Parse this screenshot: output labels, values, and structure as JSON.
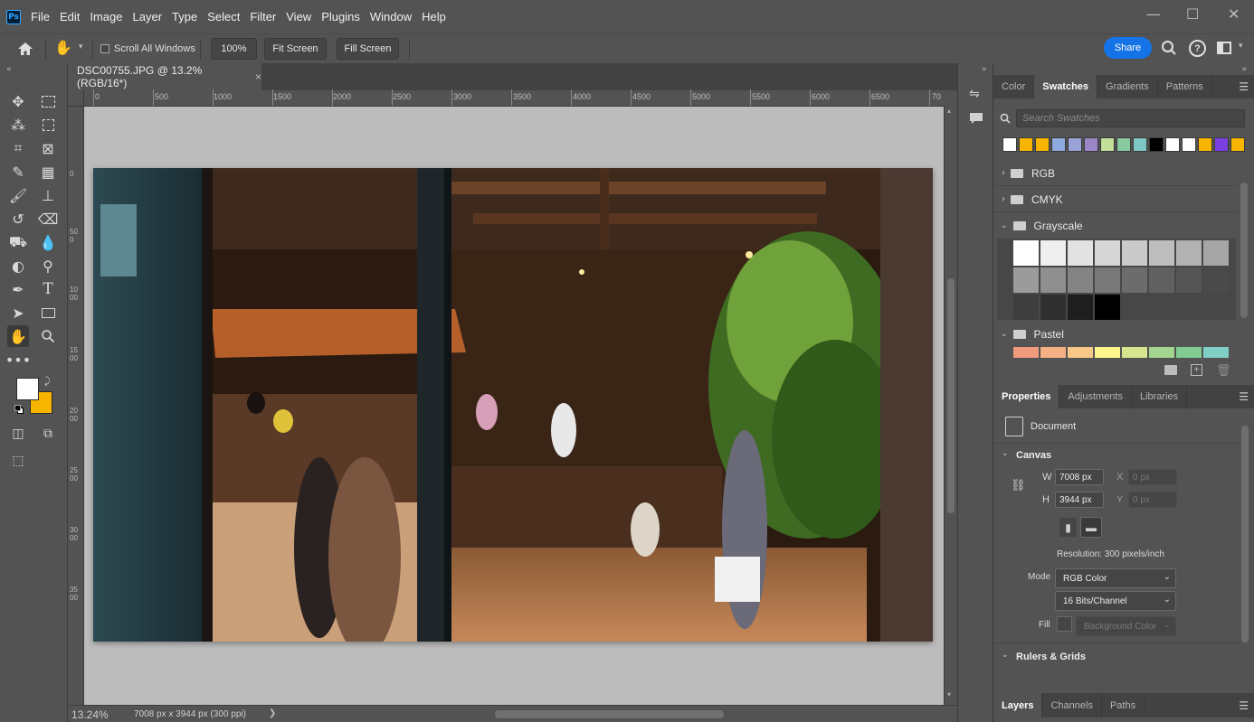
{
  "app": {
    "logo": "Ps",
    "menu": [
      "File",
      "Edit",
      "Image",
      "Layer",
      "Type",
      "Select",
      "Filter",
      "View",
      "Plugins",
      "Window",
      "Help"
    ],
    "window_controls": {
      "minimize": "—",
      "maximize": "☐",
      "close": "✕"
    }
  },
  "options_bar": {
    "scroll_all_windows": "Scroll All Windows",
    "zoom_100": "100%",
    "fit_screen": "Fit Screen",
    "fill_screen": "Fill Screen",
    "share": "Share"
  },
  "document": {
    "tab_title": "DSC00755.JPG @ 13.2% (RGB/16*)",
    "tab_close": "×",
    "ruler_h": [
      "0",
      "500",
      "1000",
      "1500",
      "2000",
      "2500",
      "3000",
      "3500",
      "4000",
      "4500",
      "5000",
      "5500",
      "6000",
      "6500",
      "70"
    ],
    "ruler_v": [
      "0",
      "500",
      "1000",
      "1500",
      "2000",
      "2500",
      "3000",
      "3500"
    ]
  },
  "status_bar": {
    "zoom": "13.24%",
    "doc_info": "7008 px x 3944 px (300 ppi)",
    "arrow": "❯"
  },
  "swatches_panel": {
    "tabs": [
      "Color",
      "Swatches",
      "Gradients",
      "Patterns"
    ],
    "active_tab": "Swatches",
    "search_placeholder": "Search Swatches",
    "recent_colors": [
      "#ffffff",
      "#f7b500",
      "#f7b500",
      "#8eaadf",
      "#9aa3d8",
      "#9b86c8",
      "#c3df9a",
      "#88c9a0",
      "#7fc7c4",
      "#000000",
      "#ffffff",
      "#ffffff",
      "#f7b500",
      "#7a3fe0",
      "#f7b500"
    ],
    "groups": {
      "rgb": "RGB",
      "cmyk": "CMYK",
      "grayscale": "Grayscale",
      "pastel": "Pastel"
    },
    "grayscale_colors": [
      "#ffffff",
      "#efefef",
      "#e2e2e2",
      "#d6d6d6",
      "#cacaca",
      "#bebebe",
      "#b2b2b2",
      "#a6a6a6",
      "#9b9b9b",
      "#8f8f8f",
      "#848484",
      "#787878",
      "#6c6c6c",
      "#606060",
      "#555555",
      "#4a4a4a",
      "#3e3e3e",
      "#2f2f2f",
      "#1e1e1e",
      "#000000"
    ],
    "pastel_colors": [
      "#f19b7e",
      "#f5b184",
      "#f8c888",
      "#fff48c",
      "#d5e68e",
      "#a4d58e",
      "#82cc94",
      "#7fcfc6"
    ]
  },
  "properties_panel": {
    "tabs": [
      "Properties",
      "Adjustments",
      "Libraries"
    ],
    "active_tab": "Properties",
    "doc_label": "Document",
    "canvas_title": "Canvas",
    "w_label": "W",
    "w_value": "7008 px",
    "h_label": "H",
    "h_value": "3944 px",
    "x_label": "X",
    "x_value": "0 px",
    "y_label": "Y",
    "y_value": "0 px",
    "resolution": "Resolution: 300 pixels/inch",
    "mode_label": "Mode",
    "mode_value": "RGB Color",
    "bits_value": "16 Bits/Channel",
    "fill_label": "Fill",
    "fill_value": "Background Color",
    "rulers_title": "Rulers & Grids"
  },
  "layers_panel": {
    "tabs": [
      "Layers",
      "Channels",
      "Paths"
    ],
    "active_tab": "Layers"
  },
  "colors": {
    "foreground": "#ffffff",
    "background": "#f7b500",
    "accent": "#1473e6"
  }
}
